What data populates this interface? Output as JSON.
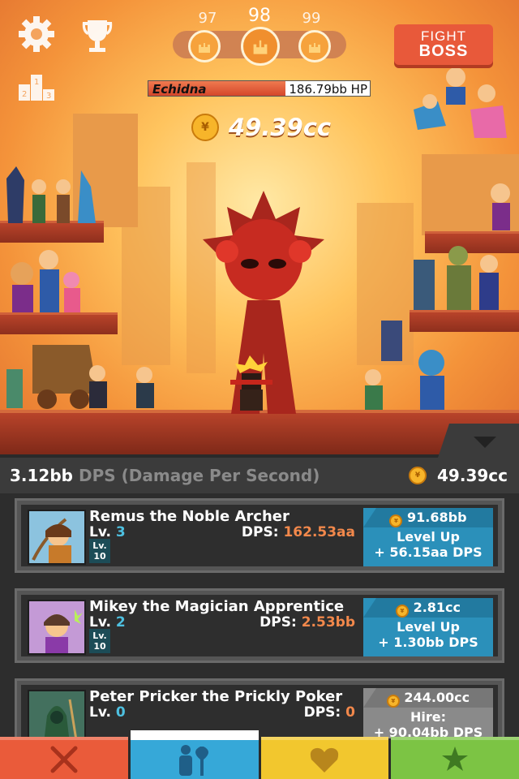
{
  "top": {
    "stage_prev": "97",
    "stage_current": "98",
    "stage_next": "99",
    "fight_boss_line1": "FIGHT",
    "fight_boss_line2": "BOSS",
    "podium_digits": [
      "1",
      "2",
      "3"
    ]
  },
  "boss": {
    "name": "Echidna",
    "hp_text": "186.79bb HP",
    "hp_fraction": 0.62
  },
  "gold_display": "49.39cc",
  "stats": {
    "dps_value": "3.12bb",
    "dps_label": "DPS (Damage Per Second)",
    "gold": "49.39cc"
  },
  "heroes": [
    {
      "name": "Remus the Noble Archer",
      "level_label": "Lv.",
      "level": "3",
      "badge_line1": "Lv.",
      "badge_line2": "10",
      "dps_label": "DPS:",
      "dps": "162.53aa",
      "cost": "91.68bb",
      "action": "Level Up",
      "action_detail": "+ 56.15aa DPS"
    },
    {
      "name": "Mikey the Magician Apprentice",
      "level_label": "Lv.",
      "level": "2",
      "badge_line1": "Lv.",
      "badge_line2": "10",
      "dps_label": "DPS:",
      "dps": "2.53bb",
      "cost": "2.81cc",
      "action": "Level Up",
      "action_detail": "+ 1.30bb DPS"
    },
    {
      "name": "Peter Pricker the Prickly Poker",
      "level_label": "Lv.",
      "level": "0",
      "dps_label": "DPS:",
      "dps": "0",
      "cost": "244.00cc",
      "action": "Hire:",
      "action_detail": "+ 90.04bb DPS"
    }
  ],
  "tabs": [
    {
      "icon": "crossed-swords-icon",
      "color": "#ea5b3a"
    },
    {
      "icon": "heroes-axe-icon",
      "color": "#36a8d8",
      "selected": true
    },
    {
      "icon": "heart-shield-icon",
      "color": "#f2c72e"
    },
    {
      "icon": "star-icon",
      "color": "#7cc444"
    }
  ],
  "colors": {
    "accent_orange": "#f2884b",
    "level_blue": "#4ec0e0",
    "button_blue": "#2b90ba",
    "fight_red": "#e8593a"
  }
}
